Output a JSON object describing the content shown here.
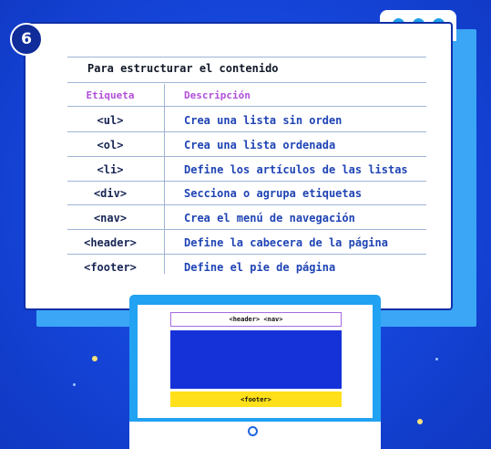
{
  "step_number": "6",
  "card": {
    "title": "Para estructurar el contenido",
    "column_headers": {
      "tag": "Etiqueta",
      "description": "Descripción"
    },
    "rows": [
      {
        "tag": "<ul>",
        "description": "Crea una lista sin orden"
      },
      {
        "tag": "<ol>",
        "description": "Crea una lista ordenada"
      },
      {
        "tag": "<li>",
        "description": "Define los artículos de las listas"
      },
      {
        "tag": "<div>",
        "description": "Secciona o agrupa etiquetas"
      },
      {
        "tag": "<nav>",
        "description": "Crea el menú de navegación"
      },
      {
        "tag": "<header>",
        "description": "Define la cabecera de la página"
      },
      {
        "tag": "<footer>",
        "description": "Define el pie de página"
      }
    ]
  },
  "monitor": {
    "header_label": "<header> <nav>",
    "footer_label": "<footer>"
  },
  "colors": {
    "background": "#1542d6",
    "accent_blue": "#22a2f2",
    "header_purple": "#b14fd9",
    "footer_yellow": "#ffe01a",
    "main_block": "#1532d8"
  }
}
